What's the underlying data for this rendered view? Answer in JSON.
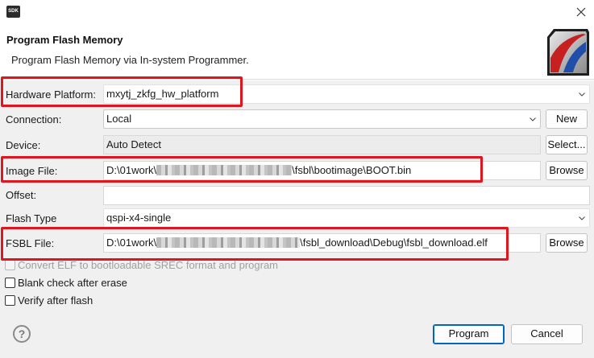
{
  "window": {
    "app_icon_text": "SDK",
    "close_icon": "close-icon"
  },
  "header": {
    "title": "Program Flash Memory",
    "description": "Program Flash Memory via In-system Programmer.",
    "logo_icon": "sdk-logo-icon"
  },
  "form": {
    "hardware_platform": {
      "label": "Hardware Platform:",
      "value": "mxytj_zkfg_hw_platform"
    },
    "connection": {
      "label": "Connection:",
      "value": "Local",
      "new_button": "New"
    },
    "device": {
      "label": "Device:",
      "value": "Auto Detect",
      "select_button": "Select..."
    },
    "image_file": {
      "label": "Image File:",
      "value_prefix": "D:\\01work\\",
      "value_suffix": "\\fsbl\\bootimage\\BOOT.bin",
      "browse_button": "Browse"
    },
    "offset": {
      "label": "Offset:",
      "value": ""
    },
    "flash_type": {
      "label": "Flash Type",
      "value": "qspi-x4-single"
    },
    "fsbl_file": {
      "label": "FSBL File:",
      "value_prefix": "D:\\01work\\",
      "value_suffix": "\\fsbl_download\\Debug\\fsbl_download.elf",
      "browse_button": "Browse"
    }
  },
  "options": {
    "convert_elf": {
      "label": "Convert ELF to bootloadable SREC format and program",
      "checked": false,
      "enabled": false
    },
    "blank_check": {
      "label": "Blank check after erase",
      "checked": false,
      "enabled": true
    },
    "verify": {
      "label": "Verify after flash",
      "checked": false,
      "enabled": true
    }
  },
  "footer": {
    "help_icon": "help-icon",
    "help_glyph": "?",
    "program_button": "Program",
    "cancel_button": "Cancel"
  },
  "colors": {
    "highlight_box": "#e0161f",
    "primary_button_border": "#0067c0"
  }
}
